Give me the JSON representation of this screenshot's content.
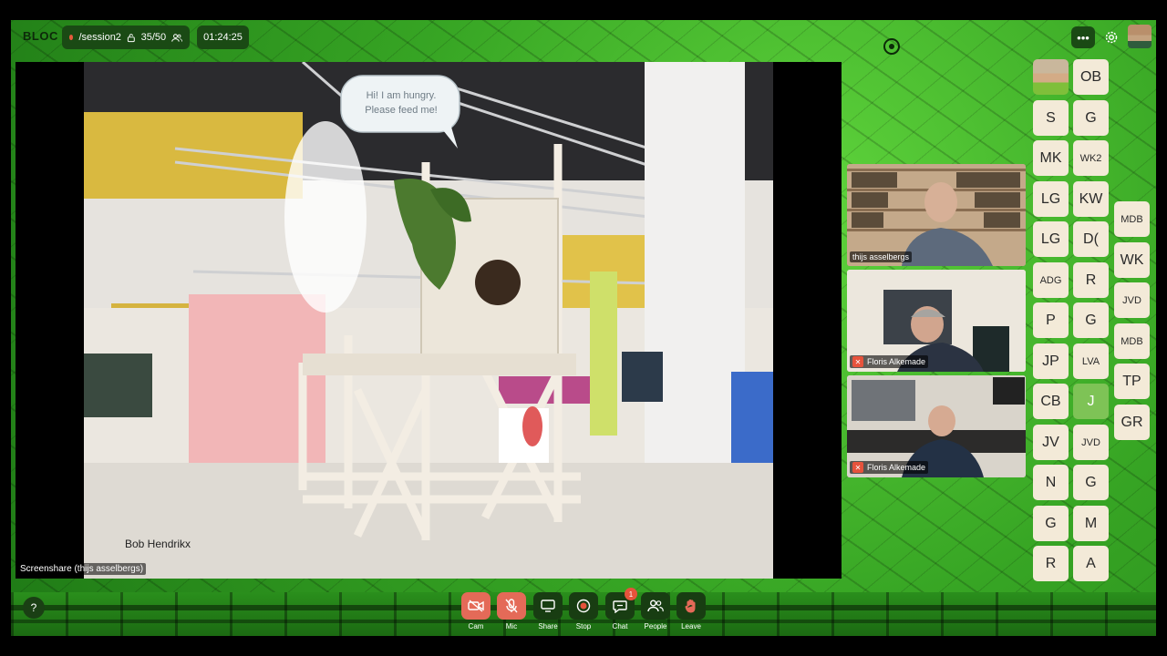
{
  "app": {
    "logo": "BLOC",
    "session_path": "/session2",
    "capacity": "35/50",
    "elapsed": "01:24:25",
    "more_label": "•••"
  },
  "screenshare": {
    "label": "Screenshare (thijs asselbergs)",
    "speech_bubble": "Hi! I am hungry. Please feed me!",
    "caption": "Bob Hendrikx"
  },
  "tiles": [
    {
      "name": "thijs asselbergs",
      "muted": false
    },
    {
      "name": "Floris Alkemade",
      "muted": true
    },
    {
      "name": "Floris Alkemade",
      "muted": true
    }
  ],
  "avatars": {
    "col_a": [
      "S",
      "MK",
      "LG",
      "LG",
      "ADG",
      "P",
      "JP",
      "CB",
      "JV",
      "N",
      "G",
      "R"
    ],
    "col_b": [
      "OB",
      "G",
      "WK2",
      "KW",
      "D(",
      "R",
      "G",
      "LVA",
      "J",
      "JVD",
      "G",
      "M",
      "A"
    ],
    "col_c": [
      "MDB",
      "WK",
      "JVD",
      "MDB",
      "TP",
      "GR"
    ]
  },
  "controls": [
    {
      "label": "Cam",
      "icon": "camera-off-icon"
    },
    {
      "label": "Mic",
      "icon": "mic-off-icon"
    },
    {
      "label": "Share",
      "icon": "screen-share-icon"
    },
    {
      "label": "Stop",
      "icon": "record-stop-icon"
    },
    {
      "label": "Chat",
      "icon": "chat-icon",
      "badge": "1"
    },
    {
      "label": "People",
      "icon": "people-icon"
    },
    {
      "label": "Leave",
      "icon": "hand-icon"
    }
  ],
  "help_label": "?",
  "colors": {
    "accent_red": "#e46a58",
    "avatar_bg": "#f3ead8",
    "active_avatar": "#7ec356",
    "pill_bg": "#1a4a14"
  }
}
